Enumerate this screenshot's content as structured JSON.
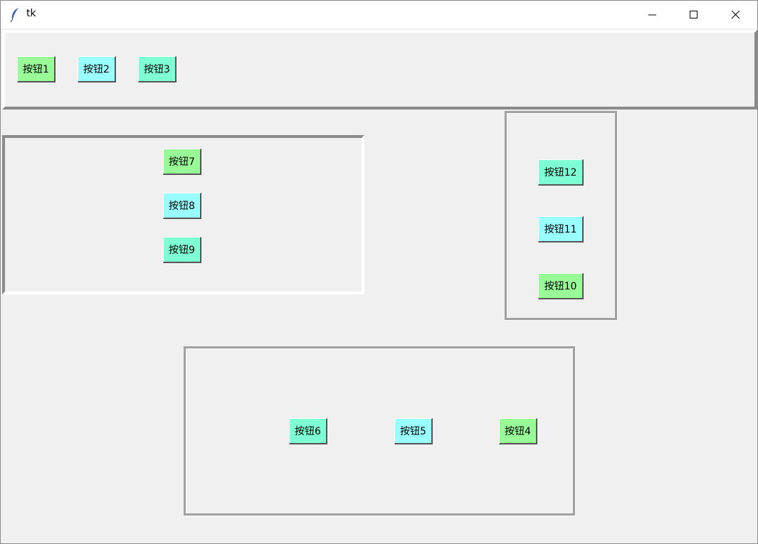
{
  "window": {
    "title": "tk",
    "controls": [
      "minimize-icon",
      "maximize-icon",
      "close-icon"
    ]
  },
  "colors": {
    "palegreen": "#98fb98",
    "lightcyan": "#99ffff",
    "aquamarine": "#7fffd4"
  },
  "top_frame": {
    "buttons": [
      "按钮1",
      "按钮2",
      "按钮3"
    ]
  },
  "left_frame": {
    "buttons": [
      "按钮7",
      "按钮8",
      "按钮9"
    ]
  },
  "right_frame": {
    "buttons": [
      "按钮12",
      "按钮11",
      "按钮10"
    ]
  },
  "bottom_frame": {
    "buttons": [
      "按钮6",
      "按钮5",
      "按钮4"
    ]
  }
}
